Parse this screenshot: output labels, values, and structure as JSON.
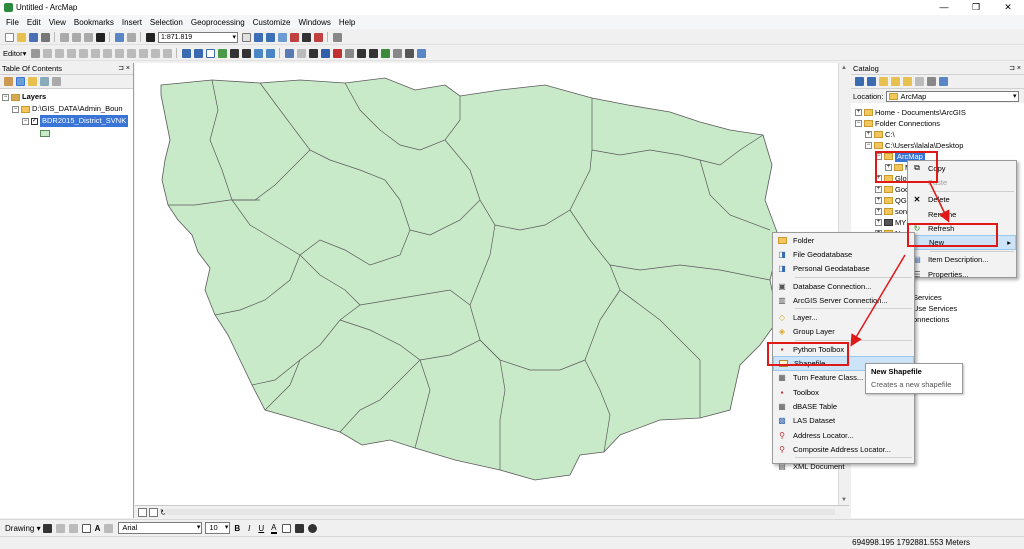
{
  "window": {
    "title": "Untitled - ArcMap",
    "min": "—",
    "max": "❐",
    "close": "✕"
  },
  "menu": [
    "File",
    "Edit",
    "View",
    "Bookmarks",
    "Insert",
    "Selection",
    "Geoprocessing",
    "Customize",
    "Windows",
    "Help"
  ],
  "toolbar": {
    "scale": "1:871.819",
    "editor": "Editor▾"
  },
  "toc": {
    "title": "Table Of Contents",
    "pin": "⊐ ×",
    "layers": "Layers",
    "source": "D:\\GIS_DATA\\Admin_Boun",
    "layer": "BDR2015_District_SVNK"
  },
  "catalog": {
    "title": "Catalog",
    "pin": "⊐ ×",
    "location_label": "Location:",
    "location_value": "ArcMap",
    "tree": [
      "Home - Documents\\ArcGIS",
      "Folder Connections",
      "C:\\",
      "C:\\Users\\lalala\\Desktop",
      "ArcMap",
      "M",
      "Glob",
      "Goo",
      "QGI",
      "song",
      "MY",
      "Na"
    ],
    "partial": [
      "Services",
      "Use Services",
      "onnections"
    ]
  },
  "context_menu": [
    {
      "icon": "copy-icon",
      "label": "Copy",
      "disabled": false
    },
    {
      "icon": "paste-icon",
      "label": "Paste",
      "disabled": true
    },
    {
      "icon": "delete-icon",
      "label": "Delete",
      "disabled": false
    },
    {
      "icon": "",
      "label": "Rename",
      "disabled": false
    },
    {
      "icon": "refresh-icon",
      "label": "Refresh",
      "disabled": false
    },
    {
      "icon": "",
      "label": "New",
      "disabled": false
    },
    {
      "icon": "item-description-icon",
      "label": "Item Description...",
      "disabled": false
    },
    {
      "icon": "properties-icon",
      "label": "Properties...",
      "disabled": false
    }
  ],
  "new_menu": [
    "Folder",
    "File Geodatabase",
    "Personal Geodatabase",
    "Database Connection...",
    "ArcGIS Server Connection...",
    "Layer...",
    "Group Layer",
    "Python Toolbox",
    "Shapefile...",
    "Turn Feature Class...",
    "Toolbox",
    "dBASE Table",
    "LAS Dataset",
    "Address Locator...",
    "Composite Address Locator...",
    "XML Document"
  ],
  "tooltip": {
    "title": "New Shapefile",
    "desc": "Creates a new shapefile"
  },
  "drawing": {
    "label": "Drawing ▾",
    "font": "Arial",
    "size": "10",
    "bold": "B",
    "italic": "I",
    "underline": "U",
    "fontcolor": "A"
  },
  "status": {
    "coords": "694998.195  1792881.553 Meters"
  },
  "colors": {
    "map_fill": "#c8eac8",
    "map_stroke": "#5a5a5a",
    "selection": "#3875d7",
    "highlight_red": "#e01818"
  }
}
